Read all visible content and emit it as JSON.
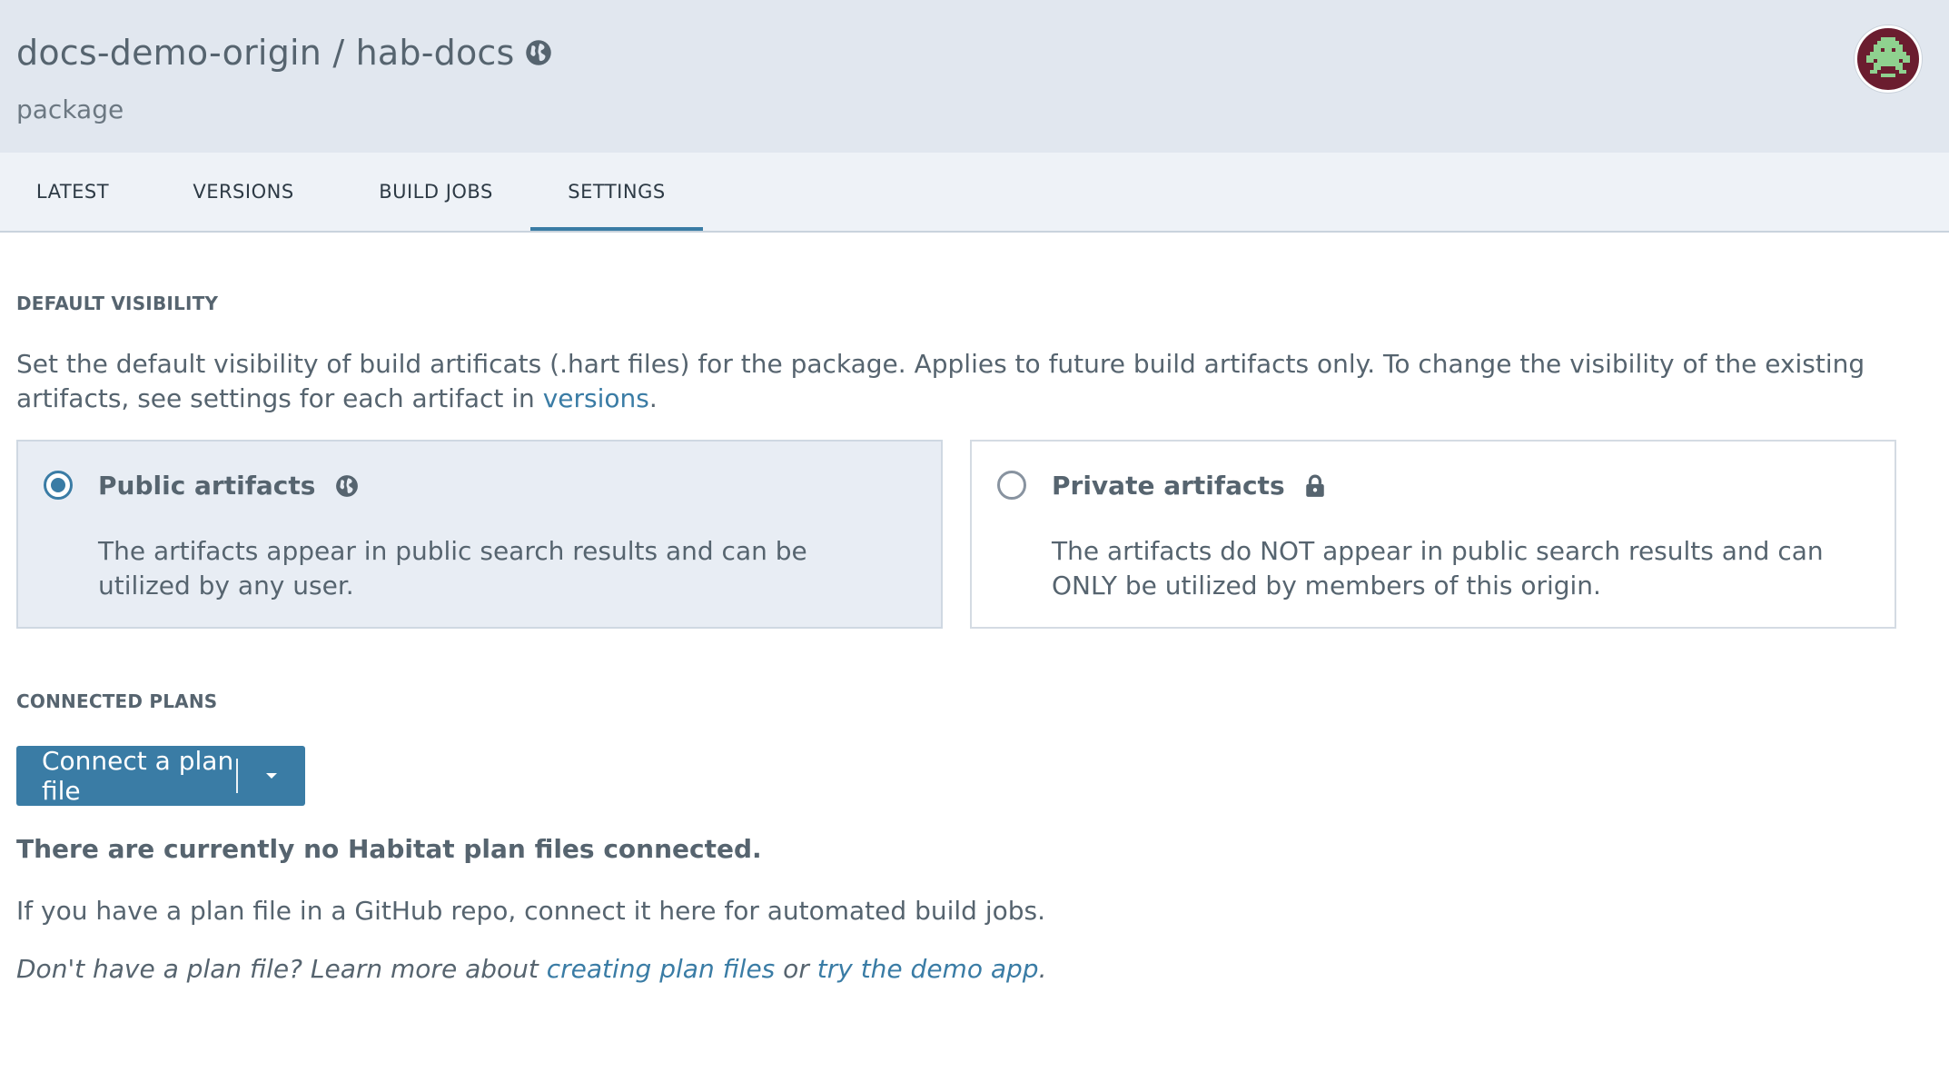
{
  "header": {
    "title": "docs-demo-origin / hab-docs",
    "subtitle": "package",
    "title_icon": "globe-icon",
    "avatar_icon": "pixel-invader-avatar"
  },
  "tabs": [
    {
      "label": "LATEST",
      "active": false
    },
    {
      "label": "VERSIONS",
      "active": false
    },
    {
      "label": "BUILD JOBS",
      "active": false
    },
    {
      "label": "SETTINGS",
      "active": true
    }
  ],
  "visibility": {
    "section_title": "DEFAULT VISIBILITY",
    "description_prefix": "Set the default visibility of build artificats (.hart files) for the package. Applies to future build artifacts only. To change the visibility of the existing artifacts, see settings for each artifact in ",
    "description_link": "versions",
    "description_suffix": ".",
    "options": [
      {
        "label": "Public artifacts",
        "icon": "globe-icon",
        "selected": true,
        "text": "The artifacts appear in public search results and can be utilized by any user."
      },
      {
        "label": "Private artifacts",
        "icon": "lock-icon",
        "selected": false,
        "text": "The artifacts do NOT appear in public search results and can ONLY be utilized by members of this origin."
      }
    ]
  },
  "plans": {
    "section_title": "CONNECTED PLANS",
    "connect_button": "Connect a plan file",
    "empty_message": "There are currently no Habitat plan files connected.",
    "hint": "If you have a plan file in a GitHub repo, connect it here for automated build jobs.",
    "learn_prefix": "Don't have a plan file? Learn more about ",
    "learn_link1": "creating plan files",
    "learn_middle": " or ",
    "learn_link2": "try the demo app",
    "learn_suffix": "."
  },
  "colors": {
    "accent": "#3a7ca5",
    "header_bg": "#e1e7ef",
    "tabs_bg": "#eef2f7",
    "text": "#56646f"
  }
}
